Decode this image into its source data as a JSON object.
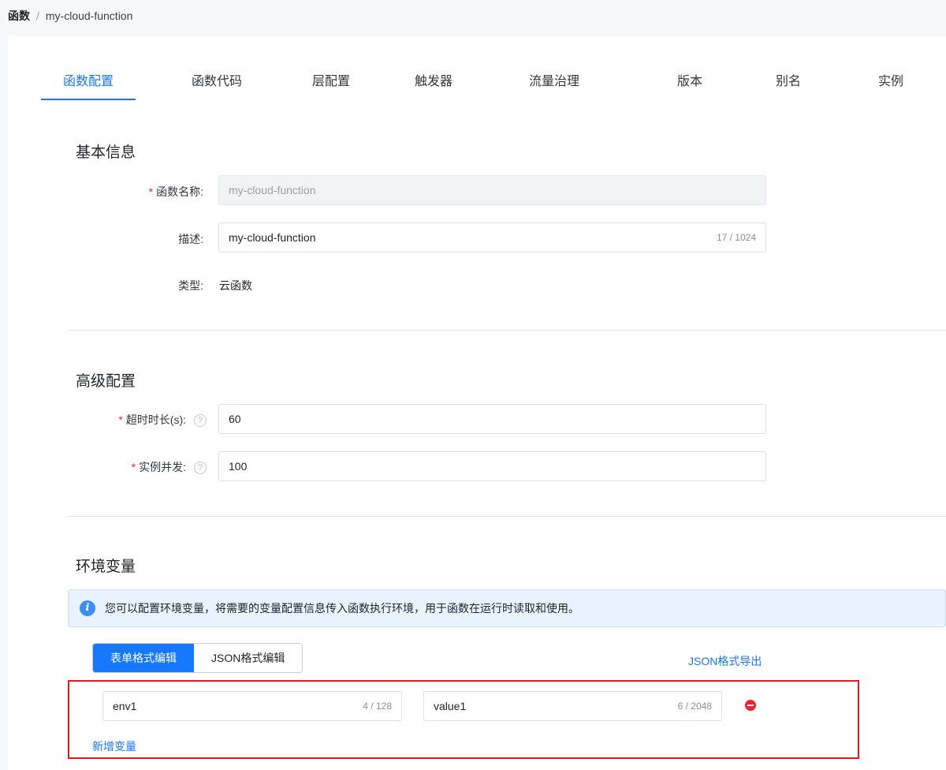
{
  "breadcrumb": {
    "root": "函数",
    "separator": "/",
    "current": "my-cloud-function"
  },
  "tabs": [
    {
      "label": "函数配置",
      "active": true
    },
    {
      "label": "函数代码"
    },
    {
      "label": "层配置"
    },
    {
      "label": "触发器"
    },
    {
      "label": "流量治理"
    },
    {
      "label": "版本"
    },
    {
      "label": "别名"
    },
    {
      "label": "实例"
    }
  ],
  "basic": {
    "title": "基本信息",
    "name_label": "函数名称:",
    "name_value": "my-cloud-function",
    "desc_label": "描述:",
    "desc_value": "my-cloud-function",
    "desc_counter": "17 / 1024",
    "type_label": "类型:",
    "type_value": "云函数"
  },
  "advanced": {
    "title": "高级配置",
    "timeout_label": "超时时长(s):",
    "timeout_value": "60",
    "concurrency_label": "实例并发:",
    "concurrency_value": "100",
    "help_glyph": "?"
  },
  "env": {
    "title": "环境变量",
    "info_glyph": "i",
    "info_text": "您可以配置环境变量，将需要的变量配置信息传入函数执行环境，用于函数在运行时读取和使用。",
    "modes": [
      {
        "label": "表单格式编辑",
        "active": true
      },
      {
        "label": "JSON格式编辑"
      }
    ],
    "export_label": "JSON格式导出",
    "variables": [
      {
        "key": "env1",
        "key_counter": "4 / 128",
        "value": "value1",
        "value_counter": "6 / 2048"
      }
    ],
    "add_label": "新增变量"
  },
  "colors": {
    "accent": "#1677ff",
    "danger": "#f5222d",
    "highlight_border": "#e31b1b"
  }
}
